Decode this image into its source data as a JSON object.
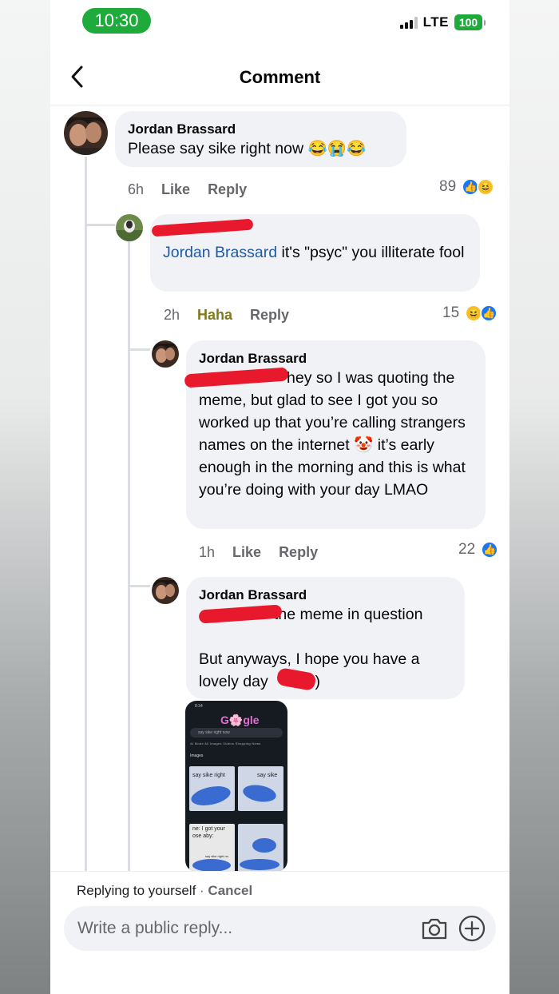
{
  "status_bar": {
    "time": "10:30",
    "network": "LTE",
    "battery": "100"
  },
  "header": {
    "title": "Comment"
  },
  "comments": [
    {
      "author": "Jordan Brassard",
      "text": "Please say sike right now 😂😭😂",
      "time": "6h",
      "like_label": "Like",
      "reply_label": "Reply",
      "reaction_count": "89",
      "reaction_icons": [
        "like-icon",
        "haha-icon"
      ]
    },
    {
      "mention": "Jordan Brassard",
      "text": " it's \"psyc\" you illiterate fool",
      "time": "2h",
      "like_label": "Haha",
      "reply_label": "Reply",
      "reaction_count": "15",
      "reaction_icons": [
        "haha-icon",
        "like-icon"
      ]
    },
    {
      "author": "Jordan Brassard",
      "text": "hey so I was quoting the meme, but glad to see I got you so worked up that you’re calling strangers names on the internet 🤡 it’s early enough in the morning and this is what you’re doing with your day LMAO",
      "time": "1h",
      "like_label": "Like",
      "reply_label": "Reply",
      "reaction_count": "22",
      "reaction_icons": [
        "like-icon"
      ]
    },
    {
      "author": "Jordan Brassard",
      "text_line1": " the meme in question",
      "text_line2": "But anyways, I hope you have a lovely day ",
      "text_end": ":)"
    }
  ],
  "attachment": {
    "time": "8:34",
    "logo": "G🌸gle",
    "search": "say sike right now",
    "tabs": "AI Mode   All   Images   Videos   Shopping   News",
    "section": "Images",
    "thumb1": "say sike right",
    "thumb2": "say sike",
    "thumb3": "ne: I got your ose aby:",
    "thumb4": "say sike right no"
  },
  "composer": {
    "replying_to": "Replying to yourself",
    "separator": " · ",
    "cancel": "Cancel",
    "placeholder": "Write a public reply..."
  },
  "colors": {
    "status_green": "#1faa3c",
    "mention_blue": "#1e5aa8",
    "like_blue": "#1877f2",
    "redaction_red": "#e8192c"
  }
}
